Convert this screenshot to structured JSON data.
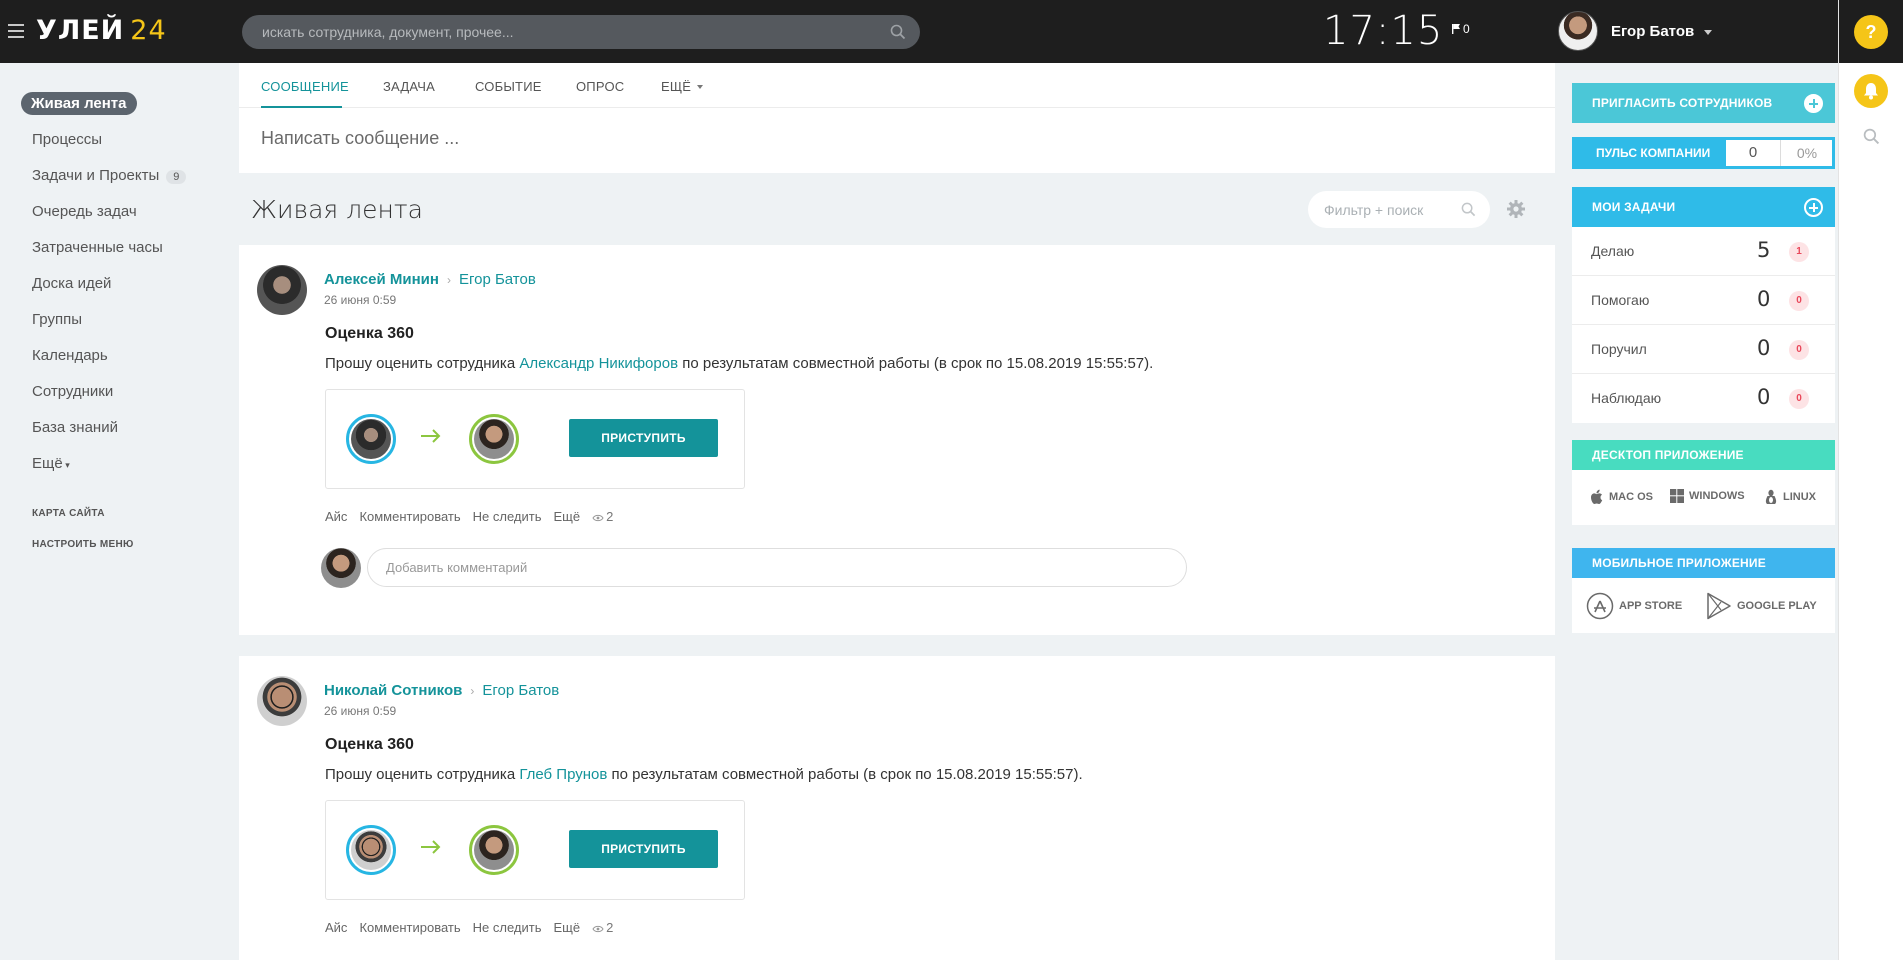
{
  "header": {
    "logo_text": "УЛЕЙ",
    "logo_number": "24",
    "search_placeholder": "искать сотрудника, документ, прочее...",
    "clock": "17:15",
    "flag_count": "0",
    "user_name": "Егор Батов",
    "help_label": "?"
  },
  "sidebar": {
    "active": "Живая лента",
    "items": [
      "Процессы",
      "Задачи и Проекты",
      "Очередь задач",
      "Затраченные часы",
      "Доска идей",
      "Группы",
      "Календарь",
      "Сотрудники",
      "База знаний",
      "Ещё"
    ],
    "tasks_badge": "9",
    "site_map": "КАРТА САЙТА",
    "configure_menu": "НАСТРОИТЬ МЕНЮ"
  },
  "composer": {
    "tabs": [
      "СООБЩЕНИЕ",
      "ЗАДАЧА",
      "СОБЫТИЕ",
      "ОПРОС",
      "ЕЩЁ"
    ],
    "placeholder": "Написать сообщение ..."
  },
  "feed": {
    "title": "Живая лента",
    "filter_placeholder": "Фильтр + поиск"
  },
  "posts": [
    {
      "author": "Алексей Минин",
      "recipient": "Егор Батов",
      "date": "26 июня 0:59",
      "title": "Оценка 360",
      "text_before": "Прошу оценить сотрудника ",
      "text_link": "Александр Никифоров",
      "text_after": " по результатам совместной работы (в срок по 15.08.2019 15:55:57).",
      "button": "ПРИСТУПИТЬ",
      "actions": [
        "Айс",
        "Комментировать",
        "Не следить",
        "Ещё"
      ],
      "views": "2",
      "comment_placeholder": "Добавить комментарий"
    },
    {
      "author": "Николай Сотников",
      "recipient": "Егор Батов",
      "date": "26 июня 0:59",
      "title": "Оценка 360",
      "text_before": "Прошу оценить сотрудника ",
      "text_link": "Глеб Прунов",
      "text_after": " по результатам совместной работы (в срок по 15.08.2019 15:55:57).",
      "button": "ПРИСТУПИТЬ",
      "actions": [
        "Айс",
        "Комментировать",
        "Не следить",
        "Ещё"
      ],
      "views": "2"
    }
  ],
  "right": {
    "invite": "ПРИГЛАСИТЬ СОТРУДНИКОВ",
    "pulse": {
      "label": "ПУЛЬС КОМПАНИИ",
      "value": "0",
      "percent": "0%"
    },
    "my_tasks": {
      "title": "МОИ ЗАДАЧИ",
      "rows": [
        {
          "label": "Делаю",
          "count": "5",
          "badge": "1"
        },
        {
          "label": "Помогаю",
          "count": "0",
          "badge": "0"
        },
        {
          "label": "Поручил",
          "count": "0",
          "badge": "0"
        },
        {
          "label": "Наблюдаю",
          "count": "0",
          "badge": "0"
        }
      ]
    },
    "desktop": {
      "title": "ДЕСКТОП ПРИЛОЖЕНИЕ",
      "items": [
        "MAC OS",
        "WINDOWS",
        "LINUX"
      ]
    },
    "mobile": {
      "title": "МОБИЛЬНОЕ ПРИЛОЖЕНИЕ",
      "items": [
        "APP STORE",
        "GOOGLE PLAY"
      ]
    }
  },
  "colors": {
    "accent": "#14939a",
    "header_bg": "#1e1e1e",
    "invite_bg": "#4bc7d7",
    "tasks_bg": "#2fbbe8",
    "desktop_bg": "#48dcc0",
    "logo_yellow": "#f5c518"
  }
}
